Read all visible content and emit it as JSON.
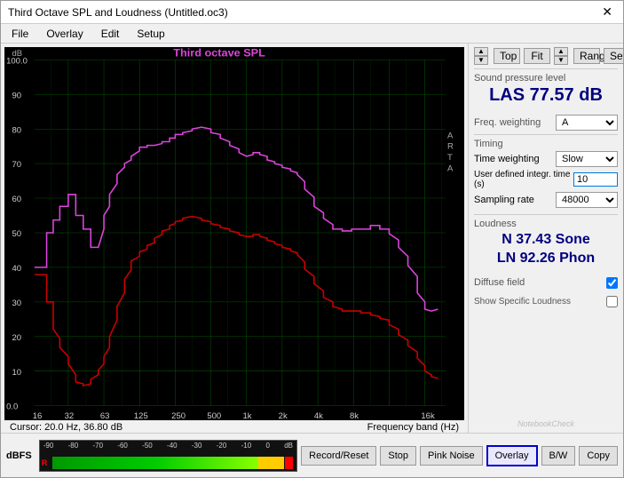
{
  "window": {
    "title": "Third Octave SPL and Loudness (Untitled.oc3)",
    "close_icon": "✕"
  },
  "menu": {
    "items": [
      "File",
      "Overlay",
      "Edit",
      "Setup"
    ]
  },
  "chart": {
    "title": "Third octave SPL",
    "y_label": "dB",
    "y_max": "100.0",
    "x_labels": [
      "16",
      "32",
      "63",
      "125",
      "250",
      "500",
      "1k",
      "2k",
      "4k",
      "8k",
      "16k"
    ],
    "y_ticks": [
      "100.0",
      "90",
      "80",
      "70",
      "60",
      "50",
      "40",
      "30",
      "20",
      "10",
      "0.0"
    ],
    "arta_label": "ARTA",
    "cursor_text": "Cursor:  20.0 Hz, 36.80 dB",
    "freq_band_label": "Frequency band (Hz)"
  },
  "right_panel": {
    "top_label": "Top",
    "fit_label": "Fit",
    "range_label": "Range",
    "set_label": "Set",
    "spl_section_label": "Sound pressure level",
    "spl_value": "LAS 77.57 dB",
    "freq_weighting_label": "Freq. weighting",
    "freq_weighting_value": "A",
    "timing_title": "Timing",
    "time_weighting_label": "Time weighting",
    "time_weighting_value": "Slow",
    "integr_time_label": "User defined integr. time (s)",
    "integr_time_value": "10",
    "sampling_rate_label": "Sampling rate",
    "sampling_rate_value": "48000",
    "loudness_title": "Loudness",
    "loudness_line1": "N 37.43 Sone",
    "loudness_line2": "LN 92.26 Phon",
    "diffuse_field_label": "Diffuse field",
    "diffuse_field_checked": true,
    "show_specific_label": "Show Specific Loudness",
    "show_specific_checked": false
  },
  "bottom_bar": {
    "dbfs_label": "dBFS",
    "meter_ticks": [
      "-90",
      "-80",
      "-70",
      "-60",
      "-50",
      "-40",
      "-30",
      "-20",
      "-10",
      "0",
      "dB"
    ],
    "r_label": "R",
    "buttons": {
      "record_reset": "Record/Reset",
      "stop": "Stop",
      "pink_noise": "Pink Noise",
      "overlay": "Overlay",
      "bw": "B/W",
      "copy": "Copy"
    }
  }
}
